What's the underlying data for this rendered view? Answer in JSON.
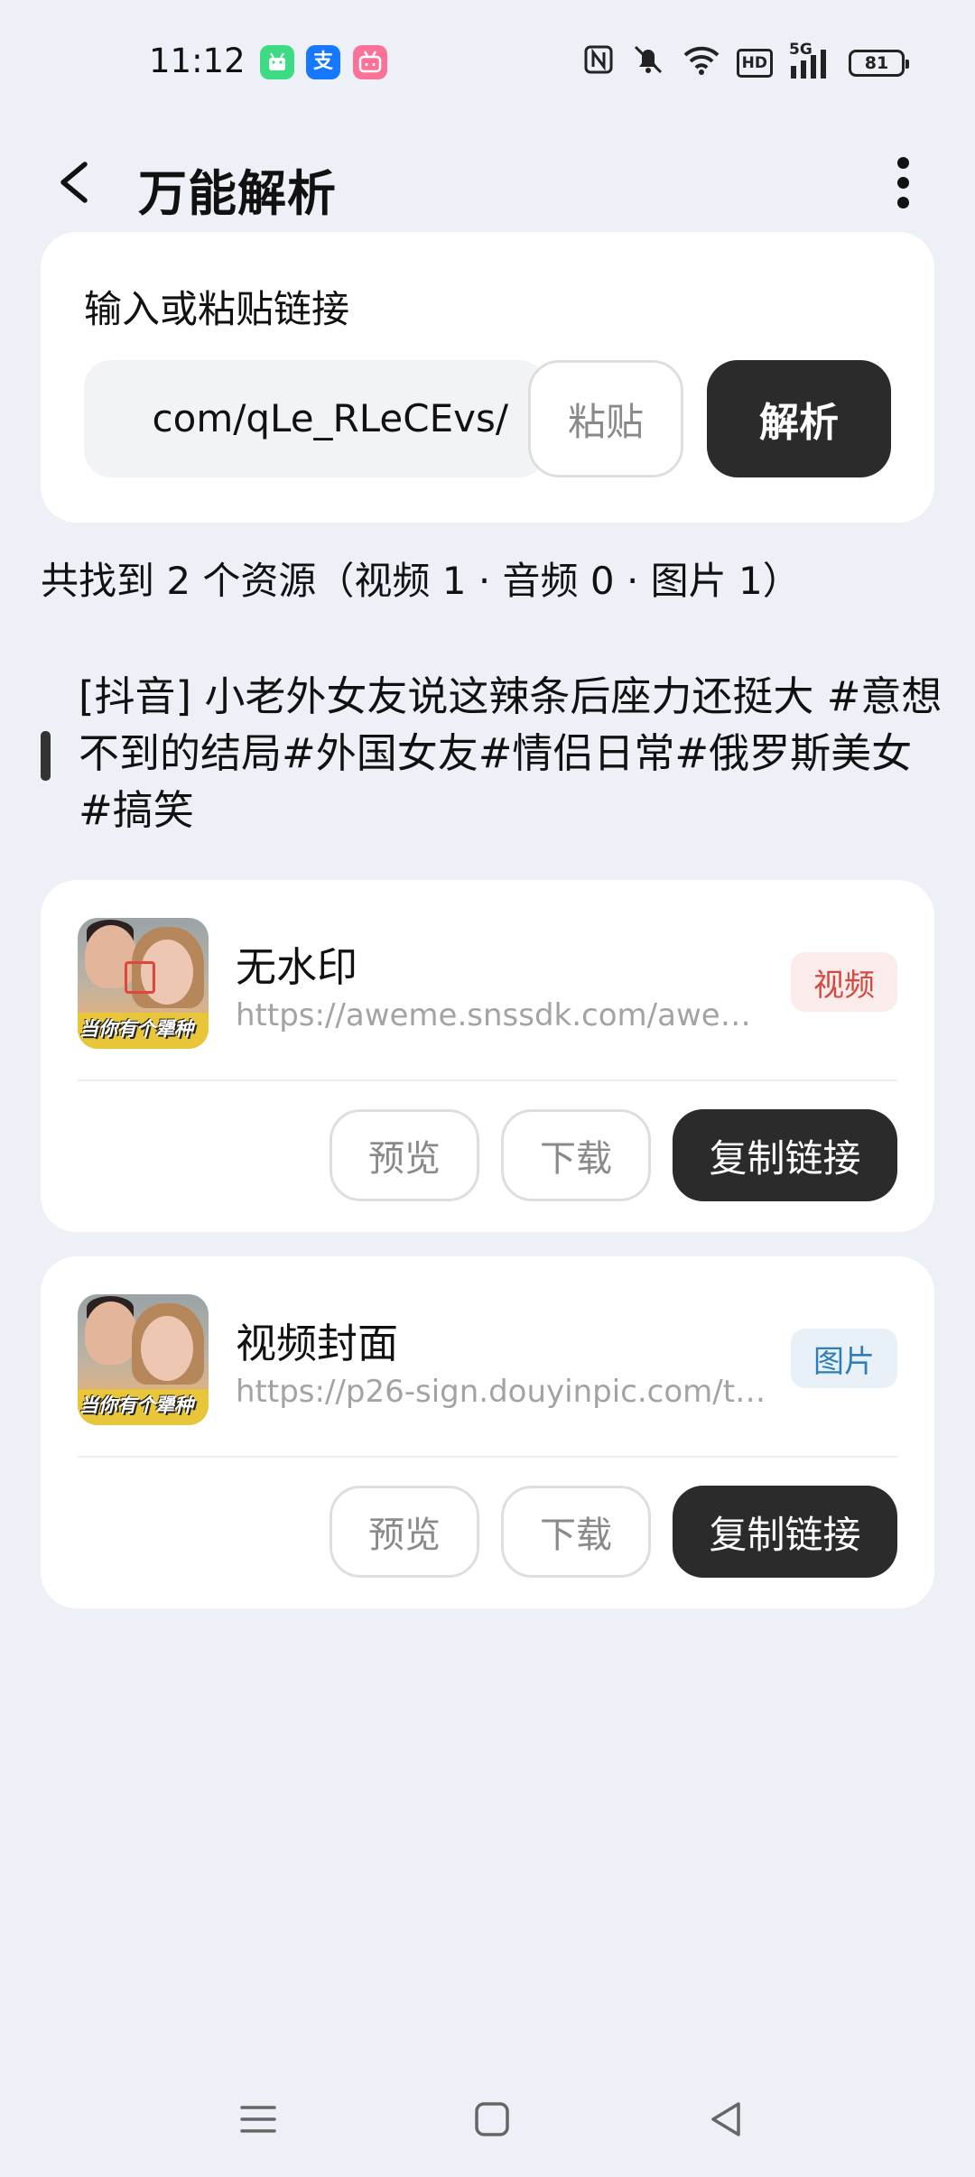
{
  "status_bar": {
    "time": "11:12",
    "notification_icons": [
      {
        "name": "android-app-icon",
        "color": "#3ddc84"
      },
      {
        "name": "alipay-icon",
        "color": "#1677ff"
      },
      {
        "name": "bilibili-icon",
        "color": "#fb7299"
      }
    ],
    "network_label": "5G",
    "hd_label": "HD",
    "battery_level": "81"
  },
  "header": {
    "title": "万能解析"
  },
  "input_card": {
    "label": "输入或粘贴链接",
    "url_value": "com/qLe_RLeCEvs/",
    "paste_label": "粘贴",
    "parse_label": "解析"
  },
  "summary": "共找到 2 个资源（视频 1 · 音频 0 · 图片 1）",
  "post_title": "[抖音] 小老外女友说这辣条后座力还挺大 #意想不到的结局#外国女友#情侣日常#俄罗斯美女#搞笑",
  "resources": [
    {
      "name": "无水印",
      "url": "https://aweme.snssdk.com/aweme/...",
      "type_badge": "视频",
      "thumb_caption": "当你有个犟种",
      "preview_label": "预览",
      "download_label": "下载",
      "copy_label": "复制链接"
    },
    {
      "name": "视频封面",
      "url": "https://p26-sign.douyinpic.com/tos-...",
      "type_badge": "图片",
      "thumb_caption": "当你有个犟种",
      "preview_label": "预览",
      "download_label": "下载",
      "copy_label": "复制链接"
    }
  ],
  "colors": {
    "background": "#eef0f7",
    "primary_button": "#2b2b2b",
    "video_badge_text": "#d24b41",
    "image_badge_text": "#2f7eb7"
  }
}
